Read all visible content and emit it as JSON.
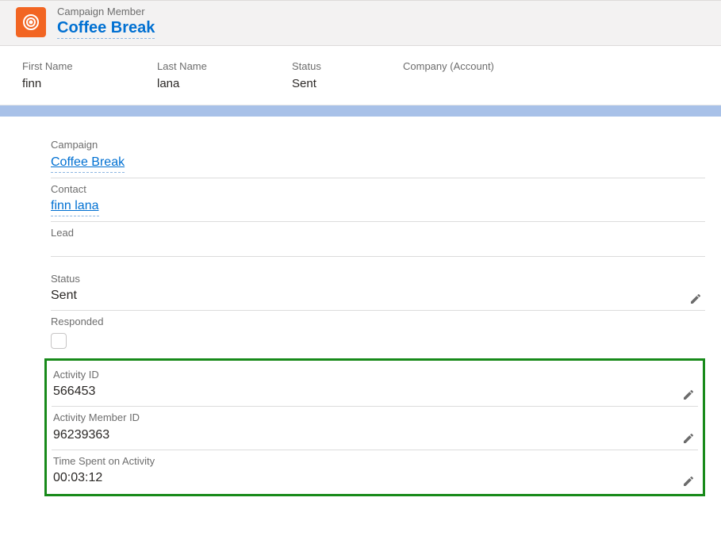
{
  "header": {
    "type_label": "Campaign Member",
    "title": "Coffee Break"
  },
  "highlights": {
    "first_name_label": "First Name",
    "first_name_value": "finn",
    "last_name_label": "Last Name",
    "last_name_value": "lana",
    "status_label": "Status",
    "status_value": "Sent",
    "company_label": "Company (Account)",
    "company_value": ""
  },
  "details": {
    "campaign_label": "Campaign",
    "campaign_value": "Coffee Break",
    "contact_label": "Contact",
    "contact_value": "finn lana",
    "lead_label": "Lead",
    "status_label": "Status",
    "status_value": "Sent",
    "responded_label": "Responded",
    "activity_id_label": "Activity ID",
    "activity_id_value": "566453",
    "activity_member_id_label": "Activity Member ID",
    "activity_member_id_value": "96239363",
    "time_spent_label": "Time Spent on Activity",
    "time_spent_value": "00:03:12"
  }
}
